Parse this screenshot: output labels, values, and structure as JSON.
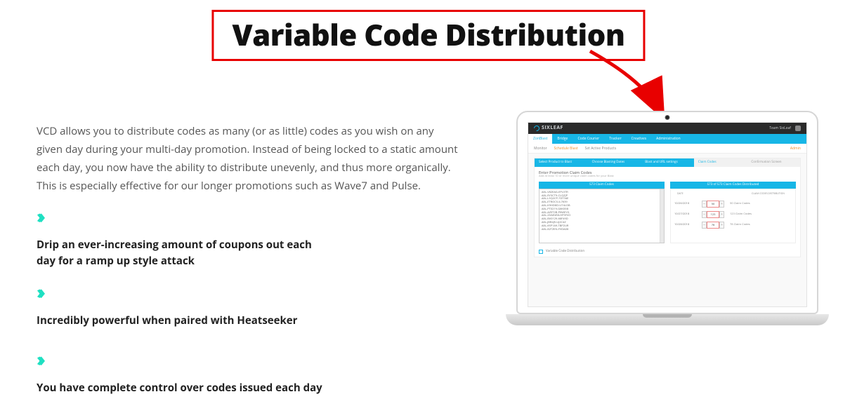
{
  "title": "Variable Code Distribution",
  "paragraph": "VCD allows you to distribute codes as many (or as little) codes as you wish on any given day during your multi-day promotion. Instead of being locked to a static amount each day, you now have the ability to distribute unevenly, and thus more organically. This is especially effective for our longer promotions such as Wave7 and Pulse.",
  "bullets": [
    "Drip an ever-increasing amount of coupons out each day for a ramp up style attack",
    "Incredibly powerful when paired with Heatseeker",
    "You have complete control over codes issued each day"
  ],
  "laptop": {
    "brand": "SIXLEAF",
    "team_label": "Team SixLeaf",
    "nav": [
      "ZonBlast",
      "Bridge",
      "Code Courier",
      "Tracker",
      "Creatives",
      "Administration"
    ],
    "subnav": {
      "monitor": "Monitor",
      "schedule": "Schedule Blast",
      "set_active": "Set Active Products",
      "admin": "Admin"
    },
    "wizard_steps": [
      "Select Product to Blast",
      "Choose Blasting Dates",
      "Blast and URL settings",
      "Claim Codes",
      "Confirmation Screen"
    ],
    "promo_head": "Enter Promotion Claim Codes",
    "promo_sub": "Add at least 10 or more unique claim codes for your Blast",
    "left_col_title": "573 Claim Codes",
    "right_col_title": "573 of 573 Claim Codes Distributed",
    "dist_header": {
      "date": "DATE",
      "label": "CLAIM CODES DISTRIBUTION"
    },
    "codes": [
      "A8L-V82EAG-EPL5TR",
      "A8L-RY5CT9-CLQZJP",
      "A8L-L3Q2CP-7DT34E",
      "A8L-ETROCX-IL7639",
      "A8L-K9HD8D-U74LOB",
      "A8L-PT0219-G8K05B",
      "A8L-AZ0T2B-P8WEYG",
      "A8L-2NMNR8-HP5FVO",
      "A8L-BV0129-68F49D",
      "A8L-JBR4J9-UJ2C4Z",
      "A8L-6SP1A9-TBP2UR",
      "A8L-82TZEN-FVDA08"
    ],
    "rows": [
      {
        "date": "10/26/2018",
        "value": "50",
        "label": "50 Claim Codes"
      },
      {
        "date": "10/27/2018",
        "value": "123",
        "label": "123 Claim Codes"
      },
      {
        "date": "10/28/2018",
        "value": "78",
        "label": "78 Claim Codes"
      }
    ],
    "vcd_label": "Variable Code Distribution"
  }
}
